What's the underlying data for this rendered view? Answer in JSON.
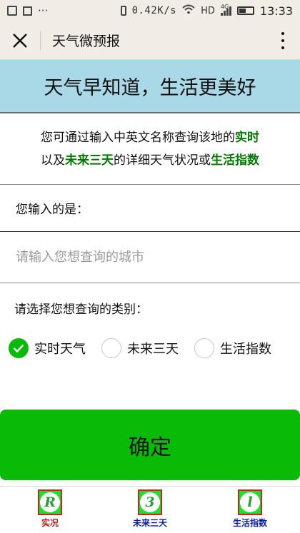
{
  "status_bar": {
    "left_dots": "···",
    "speed": "0.42K/s",
    "network": "HD",
    "signal": "4G",
    "time": "13:33"
  },
  "title_bar": {
    "title": "天气微预报"
  },
  "banner": {
    "slogan": "天气早知道，生活更美好"
  },
  "description": {
    "line1_prefix": "您可通过输入中英文名称查询该地的",
    "line1_highlight": "实时",
    "line2_prefix": "以及",
    "line2_highlight1": "未来三天",
    "line2_middle": "的详细天气状况或",
    "line2_highlight2": "生活指数"
  },
  "input_section": {
    "label": "您输入的是：",
    "value": "",
    "placeholder": "请输入您想查询的城市"
  },
  "category": {
    "label": "请选择您想查询的类别：",
    "options": [
      {
        "label": "实时天气",
        "checked": true
      },
      {
        "label": "未来三天",
        "checked": false
      },
      {
        "label": "生活指数",
        "checked": false
      }
    ]
  },
  "confirm_button": {
    "label": "确定"
  },
  "tab_bar": {
    "tabs": [
      {
        "glyph": "R",
        "label": "实况"
      },
      {
        "glyph": "3",
        "label": "未来三天"
      },
      {
        "glyph": "l",
        "label": "生活指数"
      }
    ]
  },
  "colors": {
    "accent_green": "#09bb07",
    "highlight_green": "#007a00",
    "banner_blue": "#a9d8e6",
    "header_bg": "#f2ece6"
  }
}
